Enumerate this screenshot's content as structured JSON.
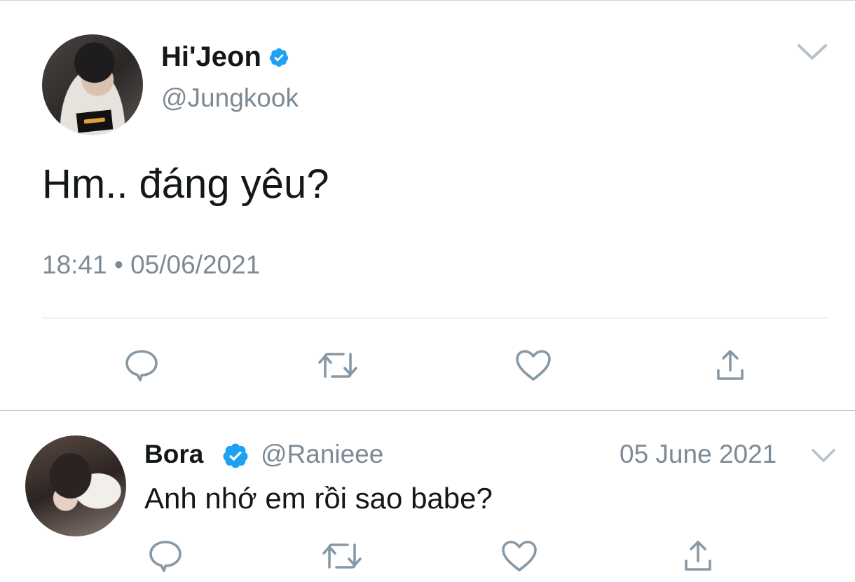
{
  "colors": {
    "text_primary": "#14171a",
    "text_secondary": "#7d8a95",
    "verified_blue": "#1da1f2",
    "icon_gray": "#8899a6",
    "divider": "#cfd6dc"
  },
  "tweet": {
    "display_name": "Hi'Jeon",
    "handle": "@Jungkook",
    "verified": true,
    "text": "Hm.. đáng yêu?",
    "timestamp": "18:41 • 05/06/2021",
    "menu_icon": "chevron-down-icon",
    "actions": [
      {
        "name": "reply",
        "icon": "comment-icon"
      },
      {
        "name": "retweet",
        "icon": "retweet-icon"
      },
      {
        "name": "like",
        "icon": "heart-icon"
      },
      {
        "name": "share",
        "icon": "share-icon"
      }
    ]
  },
  "reply": {
    "display_name": "Bora",
    "handle": "@Ranieee",
    "verified": true,
    "date": "05 June 2021",
    "text": "Anh nhớ em rồi sao babe?",
    "menu_icon": "chevron-down-icon",
    "actions": [
      {
        "name": "reply",
        "icon": "comment-icon"
      },
      {
        "name": "retweet",
        "icon": "retweet-icon"
      },
      {
        "name": "like",
        "icon": "heart-icon"
      },
      {
        "name": "share",
        "icon": "share-icon"
      }
    ]
  }
}
